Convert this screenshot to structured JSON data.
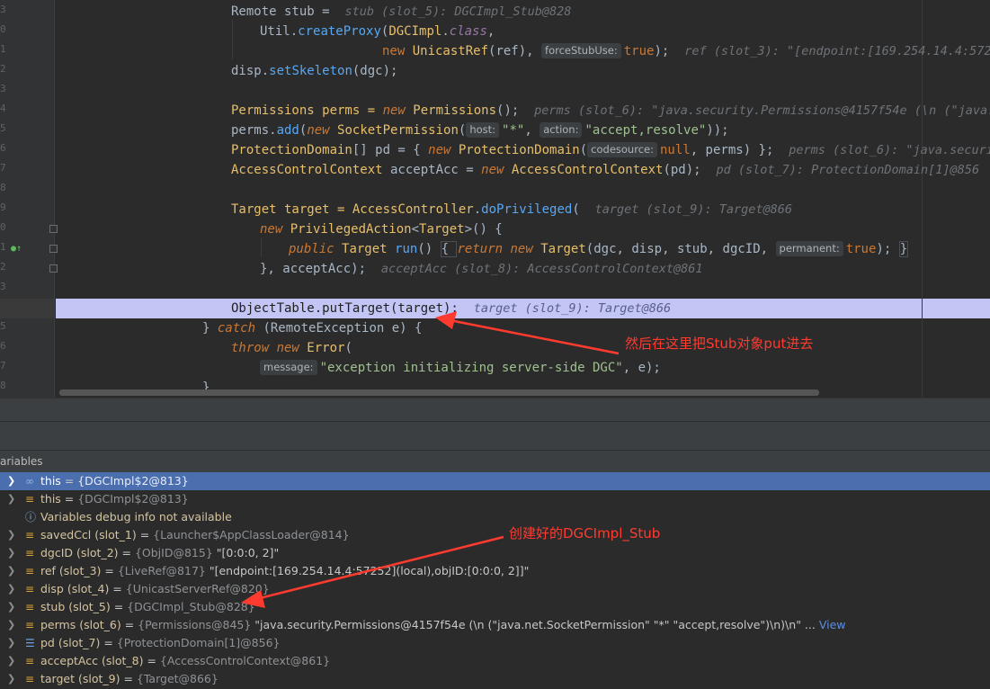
{
  "gutter": {
    "line_numbers": [
      "3",
      "0",
      "1",
      "2",
      "3",
      "4",
      "5",
      "6",
      "7",
      "8",
      "9",
      "0",
      "1",
      "2",
      "3",
      "4",
      "5",
      "6",
      "7",
      "8",
      "9",
      "0"
    ]
  },
  "code": {
    "l0": {
      "a": "Remote stub = ",
      "hint": "stub (slot_5): DGCImpl_Stub@828"
    },
    "l1": {
      "a": "Util.",
      "b": "createProxy",
      "c": "(",
      "d": "DGCImpl",
      "e": ".",
      "f": "class",
      "g": ","
    },
    "l2": {
      "a": "new ",
      "b": "UnicastRef",
      "c": "(ref), ",
      "pill": "forceStubUse:",
      "d": "true",
      "e": ");",
      "hint": "ref (slot_3): \"[endpoint:[169.254.14.4:5725"
    },
    "l3": {
      "a": "disp.",
      "b": "setSkeleton",
      "c": "(dgc);"
    },
    "l5": {
      "a": "Permissions perms = ",
      "b": "new ",
      "c": "Permissions",
      "d": "();",
      "hint": "perms (slot_6): \"java.security.Permissions@4157f54e (\\n (\"java.ne"
    },
    "l6": {
      "a": "perms.",
      "b": "add",
      "c": "(",
      "d": "new ",
      "e": "SocketPermission",
      "f": "(",
      "pill1": "host:",
      "g": "\"*\"",
      "h": ", ",
      "pill2": "action:",
      "i": "\"accept,resolve\"",
      "j": "));"
    },
    "l7": {
      "a": "ProtectionDomain",
      "b": "[] pd = { ",
      "c": "new ",
      "d": "ProtectionDomain",
      "e": "(",
      "pill": "codesource:",
      "f": "null",
      "g": ", perms) };",
      "hint": "perms (slot_6): \"java.security"
    },
    "l8": {
      "a": "AccessControlContext",
      "b": " acceptAcc = ",
      "c": "new ",
      "d": "AccessControlContext",
      "e": "(pd);",
      "hint": "pd (slot_7): ProtectionDomain[1]@856    ac"
    },
    "l10": {
      "a": "Target target = ",
      "b": "AccessController",
      "c": ".",
      "d": "doPrivileged",
      "e": "(",
      "hint": "target (slot_9): Target@866"
    },
    "l11": {
      "a": "new ",
      "b": "PrivilegedAction",
      "c": "<",
      "d": "Target",
      "e": ">() {"
    },
    "l12": {
      "a": "public ",
      "b": "Target ",
      "c": "run",
      "d": "() ",
      "e": "{ ",
      "f": "return ",
      "g": "new ",
      "h": "Target",
      "i": "(dgc, disp, stub, dgcID, ",
      "pill": "permanent:",
      "j": "true",
      "k": "); ",
      "l": "}"
    },
    "l13": {
      "a": "}, acceptAcc);",
      "hint": "acceptAcc (slot_8): AccessControlContext@861"
    },
    "l15": {
      "a": "ObjectTable.putTarget(target);",
      "hint": "target (slot_9): Target@866"
    },
    "l16": {
      "a": "} ",
      "b": "catch ",
      "c": "(RemoteException e) {"
    },
    "l17": {
      "a": "throw ",
      "b": "new ",
      "c": "Error",
      "d": "("
    },
    "l18": {
      "pill": "message:",
      "a": "\"exception initializing server-side DGC\"",
      "b": ", e);"
    },
    "l19": {
      "a": "}"
    }
  },
  "panel": {
    "title": "ariables"
  },
  "variables": [
    {
      "name": "this",
      "eq": " = ",
      "type": "{DGCImpl$2@813}",
      "val": "",
      "link": "",
      "icon": "watch-icon",
      "expand": true,
      "selected": true
    },
    {
      "name": "this",
      "eq": " = ",
      "type": "{DGCImpl$2@813}",
      "val": "",
      "link": "",
      "icon": "field-icon",
      "expand": true,
      "selected": false
    },
    {
      "name": "Variables debug info not available",
      "eq": "",
      "type": "",
      "val": "",
      "link": "",
      "icon": "info-icon",
      "expand": false,
      "selected": false
    },
    {
      "name": "savedCcl (slot_1)",
      "eq": " = ",
      "type": "{Launcher$AppClassLoader@814}",
      "val": "",
      "link": "",
      "icon": "field-icon",
      "expand": true,
      "selected": false
    },
    {
      "name": "dgcID (slot_2)",
      "eq": " = ",
      "type": "{ObjID@815}",
      "val": " \"[0:0:0, 2]\"",
      "link": "",
      "icon": "field-icon",
      "expand": true,
      "selected": false
    },
    {
      "name": "ref (slot_3)",
      "eq": " = ",
      "type": "{LiveRef@817}",
      "val": " \"[endpoint:[169.254.14.4:57252](local),objID:[0:0:0, 2]]\"",
      "link": "",
      "icon": "field-icon",
      "expand": true,
      "selected": false
    },
    {
      "name": "disp (slot_4)",
      "eq": " = ",
      "type": "{UnicastServerRef@820}",
      "val": "",
      "link": "",
      "icon": "field-icon",
      "expand": true,
      "selected": false
    },
    {
      "name": "stub (slot_5)",
      "eq": " = ",
      "type": "{DGCImpl_Stub@828}",
      "val": "",
      "link": "",
      "icon": "field-icon",
      "expand": true,
      "selected": false
    },
    {
      "name": "perms (slot_6)",
      "eq": " = ",
      "type": "{Permissions@845}",
      "val": " \"java.security.Permissions@4157f54e (\\n (\"java.net.SocketPermission\" \"*\" \"accept,resolve\")\\n)\\n\" ...",
      "link": " View",
      "icon": "field-icon",
      "expand": true,
      "selected": false
    },
    {
      "name": "pd (slot_7)",
      "eq": " = ",
      "type": "{ProtectionDomain[1]@856}",
      "val": "",
      "link": "",
      "icon": "array-icon",
      "expand": true,
      "selected": false
    },
    {
      "name": "acceptAcc (slot_8)",
      "eq": " = ",
      "type": "{AccessControlContext@861}",
      "val": "",
      "link": "",
      "icon": "field-icon",
      "expand": true,
      "selected": false
    },
    {
      "name": "target (slot_9)",
      "eq": " = ",
      "type": "{Target@866}",
      "val": "",
      "link": "",
      "icon": "field-icon",
      "expand": true,
      "selected": false
    }
  ],
  "annotations": {
    "top": "然后在这里把Stub对象put进去",
    "bottom": "创建好的DGCImpl_Stub"
  },
  "colors": {
    "accent": "#4b6eaf",
    "annotation": "#ff3b30",
    "highlight": "#c3c6f5"
  }
}
